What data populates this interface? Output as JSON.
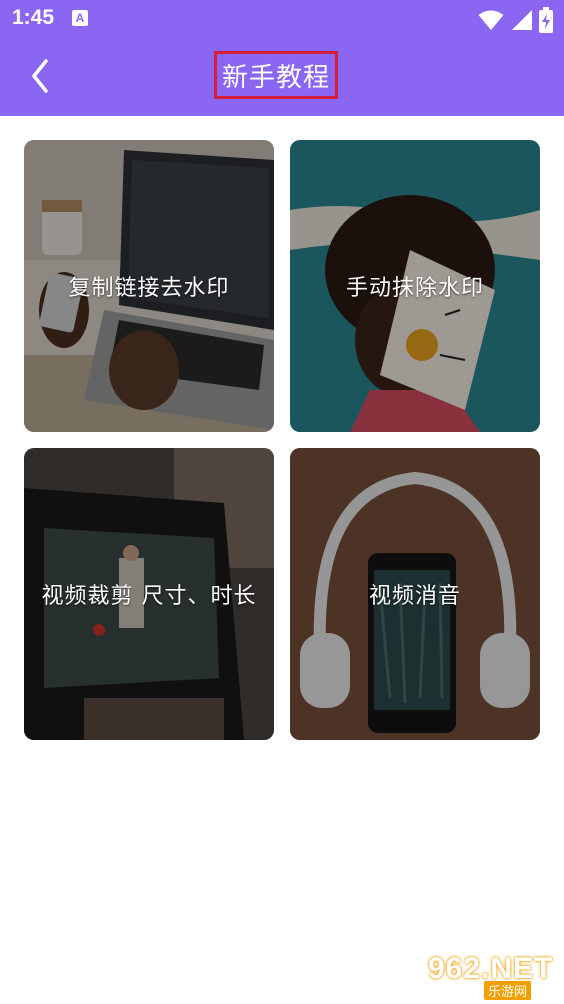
{
  "status_bar": {
    "time": "1:45",
    "notification_letter": "A"
  },
  "header": {
    "title": "新手教程"
  },
  "cards": [
    {
      "label": "复制链接去水印"
    },
    {
      "label": "手动抹除水印"
    },
    {
      "label": "视频裁剪 尺寸、时长"
    },
    {
      "label": "视频消音"
    }
  ],
  "watermark": {
    "text": "962.NET",
    "subtext": "乐游网"
  },
  "colors": {
    "appbar": "#8B66F2",
    "title_highlight": "#D41F3A"
  },
  "icons": [
    "back-arrow-icon",
    "wifi-icon",
    "signal-icon",
    "battery-icon"
  ]
}
